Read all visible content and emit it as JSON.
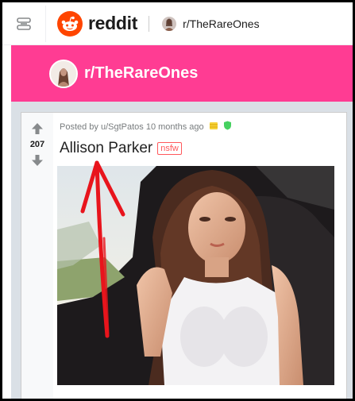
{
  "header": {
    "menu_icon": "menu-icon",
    "logo_icon": "reddit-snoo-icon",
    "logo_text": "reddit",
    "breadcrumb": "r/TheRareOnes"
  },
  "banner": {
    "title": "r/TheRareOnes"
  },
  "post": {
    "vote_count": "207",
    "meta": "Posted by u/SgtPatos 10 months ago",
    "title": "Allison Parker",
    "tag": "nsfw"
  },
  "colors": {
    "reddit_orange": "#ff4500",
    "banner_pink": "#ff3c93",
    "nsfw_red": "#ff585b",
    "annotation_red": "#e8141c"
  }
}
